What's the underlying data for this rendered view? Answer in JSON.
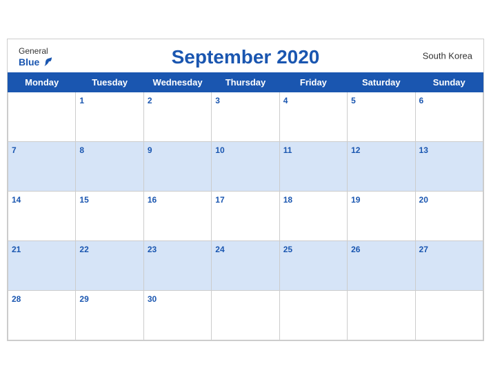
{
  "header": {
    "title": "September 2020",
    "country": "South Korea",
    "logo_general": "General",
    "logo_blue": "Blue"
  },
  "weekdays": [
    "Monday",
    "Tuesday",
    "Wednesday",
    "Thursday",
    "Friday",
    "Saturday",
    "Sunday"
  ],
  "weeks": [
    [
      null,
      1,
      2,
      3,
      4,
      5,
      6
    ],
    [
      7,
      8,
      9,
      10,
      11,
      12,
      13
    ],
    [
      14,
      15,
      16,
      17,
      18,
      19,
      20
    ],
    [
      21,
      22,
      23,
      24,
      25,
      26,
      27
    ],
    [
      28,
      29,
      30,
      null,
      null,
      null,
      null
    ]
  ]
}
